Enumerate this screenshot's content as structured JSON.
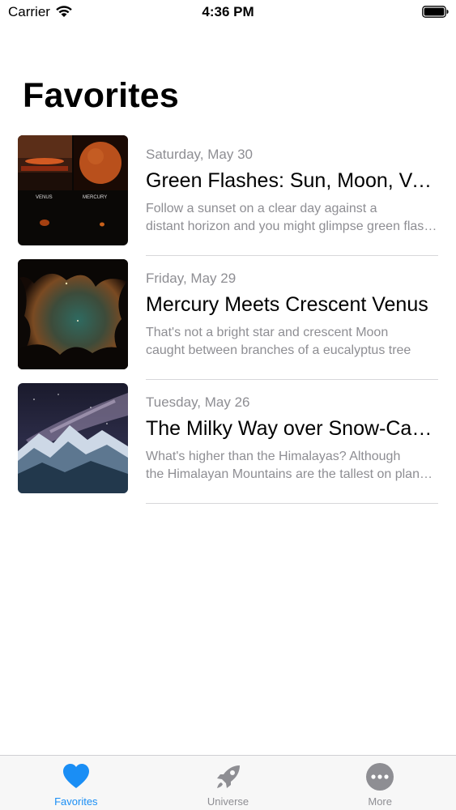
{
  "status_bar": {
    "carrier": "Carrier",
    "time": "4:36 PM"
  },
  "page": {
    "title": "Favorites"
  },
  "articles": [
    {
      "date": "Saturday, May 30",
      "title": "Green Flashes: Sun, Moon, Venus, Mercury",
      "summary_line1": "Follow a sunset on a clear day against a",
      "summary_line2": "distant horizon and you might glimpse green flashes",
      "thumb_labels": [
        "VENUS",
        "MERCURY"
      ]
    },
    {
      "date": "Friday, May 29",
      "title": "Mercury Meets Crescent Venus",
      "summary_line1": "That's not a bright star and crescent Moon",
      "summary_line2": "caught between branches of a eucalyptus tree"
    },
    {
      "date": "Tuesday, May 26",
      "title": "The Milky Way over Snow-Capped Himalayas",
      "summary_line1": "What's higher than the Himalayas? Although",
      "summary_line2": "the Himalayan Mountains are the tallest on planet Earth"
    }
  ],
  "tab_bar": {
    "tabs": [
      {
        "label": "Favorites",
        "icon": "heart-icon",
        "active": true
      },
      {
        "label": "Universe",
        "icon": "rocket-icon",
        "active": false
      },
      {
        "label": "More",
        "icon": "more-icon",
        "active": false
      }
    ]
  },
  "colors": {
    "accent": "#1a8ef5",
    "secondary_text": "#8e8e93",
    "tab_inactive": "#8e8e93"
  }
}
